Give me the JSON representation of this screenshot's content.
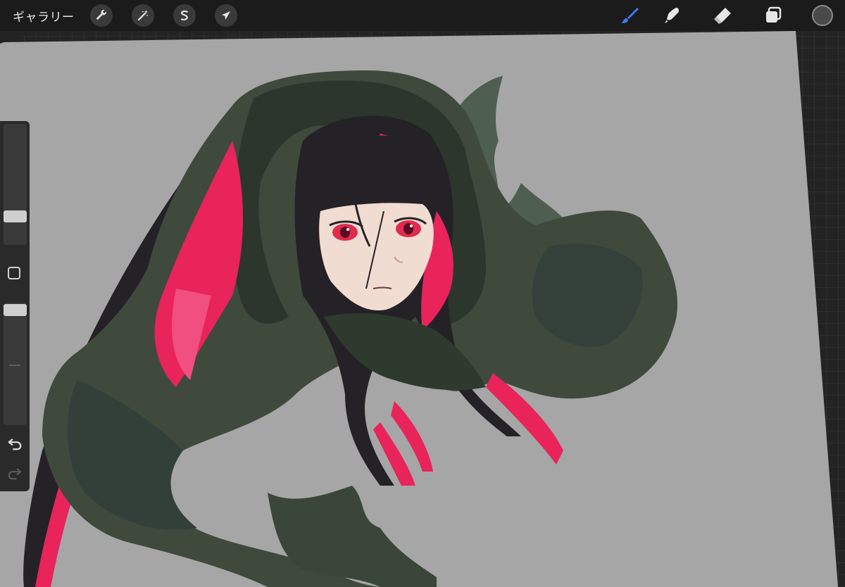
{
  "toolbar": {
    "gallery_label": "ギャラリー",
    "left_tools": [
      {
        "name": "actions",
        "icon": "wrench-icon"
      },
      {
        "name": "adjustments",
        "icon": "magic-wand-icon"
      },
      {
        "name": "selection",
        "icon": "selection-s-icon"
      },
      {
        "name": "transform",
        "icon": "arrow-cursor-icon"
      }
    ],
    "right_tools": [
      {
        "name": "brush",
        "icon": "brush-icon",
        "active": true,
        "color": "#3d7bf7"
      },
      {
        "name": "smudge",
        "icon": "smudge-finger-icon"
      },
      {
        "name": "eraser",
        "icon": "eraser-icon"
      },
      {
        "name": "layers",
        "icon": "layers-icon"
      }
    ],
    "current_color": "#4a4a4a"
  },
  "sidebar": {
    "brush_size_level": 0.2,
    "opacity_level": 1.0,
    "modify_icon": "square-icon",
    "undo_icon": "undo-arrow-icon",
    "redo_icon": "redo-arrow-icon"
  },
  "canvas": {
    "background_color": "#a6a6a6",
    "artwork": "illustration-hooded-girl"
  },
  "colors": {
    "hood_green": "#3f4a3d",
    "hood_dark": "#2d362c",
    "hair_black": "#242226",
    "hair_pink": "#e8245a",
    "skin": "#f1dcd2",
    "eye_red": "#e02a4e"
  }
}
